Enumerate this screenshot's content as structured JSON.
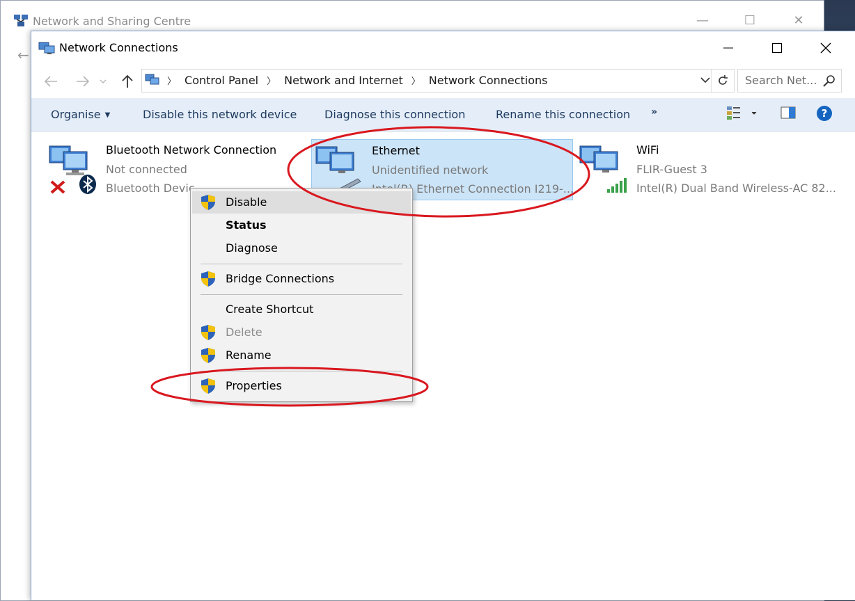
{
  "background_window": {
    "title": "Network and Sharing Centre",
    "back_glyph": "←"
  },
  "window": {
    "title": "Network Connections"
  },
  "address_bar": {
    "crumbs": [
      "Control Panel",
      "Network and Internet",
      "Network Connections"
    ],
    "search_placeholder": "Search Net..."
  },
  "command_bar": {
    "organise": "Organise",
    "disable": "Disable this network device",
    "diagnose": "Diagnose this connection",
    "rename": "Rename this connection",
    "more": "»",
    "help": "?"
  },
  "connections": [
    {
      "name": "Bluetooth Network Connection",
      "status": "Not connected",
      "device": "Bluetooth Devic"
    },
    {
      "name": "Ethernet",
      "status": "Unidentified network",
      "device": "Intel(R) Ethernet Connection I219-..."
    },
    {
      "name": "WiFi",
      "status": "FLIR-Guest  3",
      "device": "Intel(R) Dual Band Wireless-AC 82..."
    }
  ],
  "context_menu": {
    "items": [
      {
        "label": "Disable"
      },
      {
        "label": "Status"
      },
      {
        "label": "Diagnose"
      },
      {
        "label": "Bridge Connections"
      },
      {
        "label": "Create Shortcut"
      },
      {
        "label": "Delete"
      },
      {
        "label": "Rename"
      },
      {
        "label": "Properties"
      }
    ]
  },
  "colors": {
    "selection": "#cce4f7",
    "command_bar": "#e5eef8",
    "annotation": "#d9181f"
  },
  "icons": {
    "network": "network-monitor-icon",
    "shield": "uac-shield-icon",
    "bluetooth": "bluetooth-icon",
    "wifi_bars": "wifi-signal-icon",
    "error": "red-x-icon"
  }
}
